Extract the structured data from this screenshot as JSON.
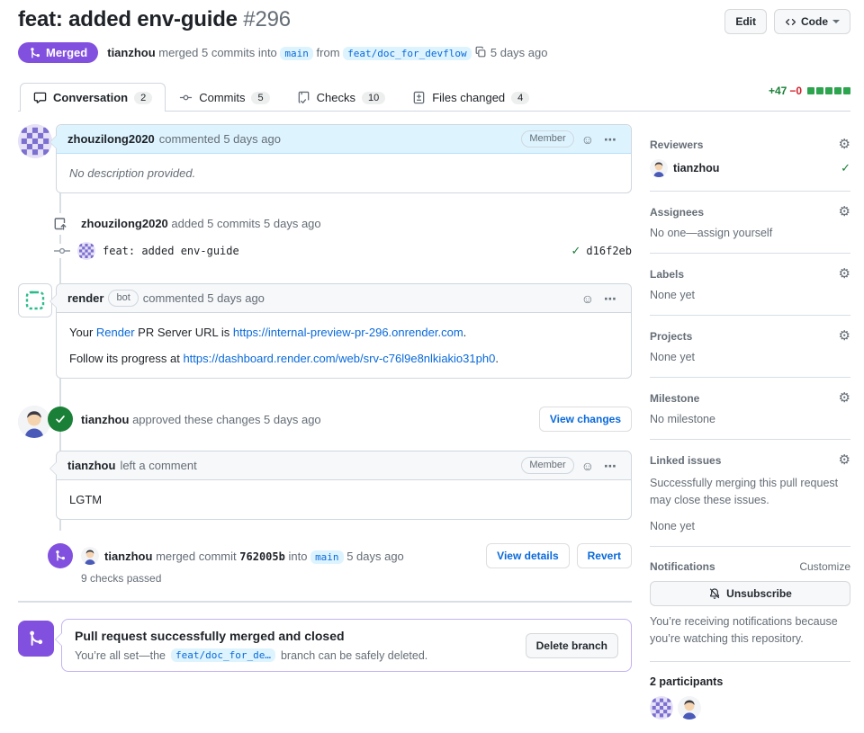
{
  "colors": {
    "merged_purple": "#8250df",
    "link_blue": "#0969da",
    "success_green": "#1a7f37",
    "deletion_red": "#cf222e"
  },
  "header": {
    "title": "feat: added env-guide",
    "number": "#296",
    "edit_button": "Edit",
    "code_button": "Code",
    "merged_badge": "Merged",
    "author": "tianzhou",
    "action": "merged 5 commits into",
    "base_branch": "main",
    "from_word": "from",
    "head_branch": "feat/doc_for_devflow",
    "time": "5 days ago"
  },
  "tabs": [
    {
      "label": "Conversation",
      "count": "2"
    },
    {
      "label": "Commits",
      "count": "5"
    },
    {
      "label": "Checks",
      "count": "10"
    },
    {
      "label": "Files changed",
      "count": "4"
    }
  ],
  "diffstat": {
    "additions": "+47",
    "deletions": "−0",
    "blocks": 5
  },
  "timeline": {
    "comment1": {
      "author": "zhouzilong2020",
      "action": "commented 5 days ago",
      "badge": "Member",
      "body": "No description provided."
    },
    "commits_event": {
      "author": "zhouzilong2020",
      "action": "added 5 commits 5 days ago"
    },
    "commit_row": {
      "message": "feat: added env-guide",
      "sha": "d16f2eb"
    },
    "bot_comment": {
      "author": "render",
      "badge": "bot",
      "action": "commented 5 days ago",
      "p1_pre": "Your ",
      "p1_link1": "Render",
      "p1_mid": " PR Server URL is ",
      "p1_link2": "https://internal-preview-pr-296.onrender.com",
      "p1_post": ".",
      "p2_pre": "Follow its progress at ",
      "p2_link": "https://dashboard.render.com/web/srv-c76l9e8nlkiakio31ph0",
      "p2_post": "."
    },
    "approved_event": {
      "author": "tianzhou",
      "action": "approved these changes 5 days ago",
      "button": "View changes"
    },
    "review_comment": {
      "author": "tianzhou",
      "action": "left a comment",
      "badge": "Member",
      "body": "LGTM"
    },
    "merged_event": {
      "author": "tianzhou",
      "action": "merged commit",
      "sha": "762005b",
      "into_word": "into",
      "branch": "main",
      "time": "5 days ago",
      "checks": "9 checks passed",
      "view_details_button": "View details",
      "revert_button": "Revert"
    },
    "merged_box": {
      "title": "Pull request successfully merged and closed",
      "pre": "You’re all set—the",
      "branch": "feat/doc_for_de…",
      "post": "branch can be safely deleted.",
      "delete_button": "Delete branch"
    }
  },
  "sidebar": {
    "reviewers": {
      "title": "Reviewers",
      "user": "tianzhou"
    },
    "assignees": {
      "title": "Assignees",
      "empty": "No one—assign yourself"
    },
    "labels": {
      "title": "Labels",
      "empty": "None yet"
    },
    "projects": {
      "title": "Projects",
      "empty": "None yet"
    },
    "milestone": {
      "title": "Milestone",
      "empty": "No milestone"
    },
    "linked_issues": {
      "title": "Linked issues",
      "desc": "Successfully merging this pull request may close these issues.",
      "empty": "None yet"
    },
    "notifications": {
      "title": "Notifications",
      "customize": "Customize",
      "button": "Unsubscribe",
      "desc": "You’re receiving notifications because you’re watching this repository."
    },
    "participants": {
      "title": "2 participants"
    }
  }
}
